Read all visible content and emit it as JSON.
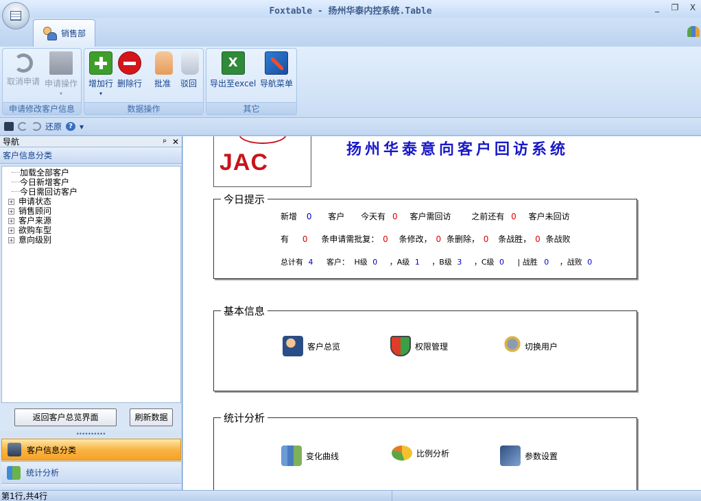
{
  "window": {
    "title": "Foxtable - 扬州华泰内控系统.Table",
    "controls": [
      "_",
      "❐",
      "X"
    ]
  },
  "ribbon": {
    "tab_label": "销售部",
    "groups": [
      {
        "label": "申请修改客户信息",
        "buttons": [
          {
            "label": "取消申请",
            "icon": "undo-icon",
            "enabled": false
          },
          {
            "label": "申请操作",
            "icon": "document-icon",
            "enabled": false,
            "dropdown": true
          }
        ]
      },
      {
        "label": "数据操作",
        "buttons": [
          {
            "label": "增加行",
            "icon": "plus-icon",
            "enabled": true,
            "dropdown": true
          },
          {
            "label": "删除行",
            "icon": "minus-icon",
            "enabled": true
          },
          {
            "label": "批准",
            "icon": "thumbs-up-icon",
            "enabled": true
          },
          {
            "label": "驳回",
            "icon": "thumbs-down-icon",
            "enabled": true
          }
        ]
      },
      {
        "label": "其它",
        "buttons": [
          {
            "label": "导出至excel",
            "icon": "excel-icon",
            "enabled": true
          },
          {
            "label": "导航菜单",
            "icon": "navigation-icon",
            "enabled": true
          }
        ]
      }
    ]
  },
  "quick_access": {
    "restore_label": "还原",
    "help": "?",
    "more": "▾"
  },
  "nav": {
    "header": "导航",
    "pin": "ᵖ",
    "close": "✕",
    "section": "客户信息分类",
    "tree": [
      {
        "label": "加载全部客户",
        "expandable": false
      },
      {
        "label": "今日新增客户",
        "expandable": false
      },
      {
        "label": "今日需回访客户",
        "expandable": false
      },
      {
        "label": "申请状态",
        "expandable": true
      },
      {
        "label": "销售顾问",
        "expandable": true
      },
      {
        "label": "客户来源",
        "expandable": true
      },
      {
        "label": "欲购车型",
        "expandable": true
      },
      {
        "label": "意向级别",
        "expandable": true
      }
    ],
    "back_button": "返回客户总览界面",
    "refresh_button": "刷新数据",
    "grip": "••••••••••",
    "panels": [
      {
        "label": "客户信息分类",
        "active": true
      },
      {
        "label": "统计分析",
        "active": false
      }
    ]
  },
  "main": {
    "logo_text": "JAC",
    "system_title": "扬州华泰意向客户回访系统",
    "today": {
      "legend": "今日提示",
      "row1": {
        "a": "新增",
        "v1": "0",
        "b": "客户",
        "c": "今天有",
        "v2": "0",
        "d": "客户需回访",
        "e": "之前还有",
        "v3": "0",
        "f": "客户未回访"
      },
      "row2": {
        "a": "有",
        "v1": "0",
        "b": "条申请需批复：",
        "v2": "0",
        "c": "条修改，",
        "v3": "0",
        "d": "条删除，",
        "v4": "0",
        "e": "条战胜，",
        "v5": "0",
        "f": "条战败"
      },
      "row3": {
        "a": "总计有",
        "v1": "4",
        "b": "客户：",
        "c": "H级",
        "v2": "0",
        "d": "，A级",
        "v3": "1",
        "e": "，B级",
        "v4": "3",
        "f": "，C级",
        "v5": "0",
        "g": "| 战胜",
        "v6": "0",
        "h": "，战败",
        "v7": "0"
      }
    },
    "basic": {
      "legend": "基本信息",
      "items": [
        {
          "label": "客户总览",
          "icon": "customer-overview-icon"
        },
        {
          "label": "权限管理",
          "icon": "shield-icon"
        },
        {
          "label": "切换用户",
          "icon": "switch-user-icon"
        }
      ]
    },
    "stats": {
      "legend": "统计分析",
      "items": [
        {
          "label": "变化曲线",
          "icon": "line-chart-icon"
        },
        {
          "label": "比例分析",
          "icon": "pie-chart-icon"
        },
        {
          "label": "参数设置",
          "icon": "settings-icon"
        }
      ]
    }
  },
  "status": {
    "text": "第1行,共4行"
  }
}
